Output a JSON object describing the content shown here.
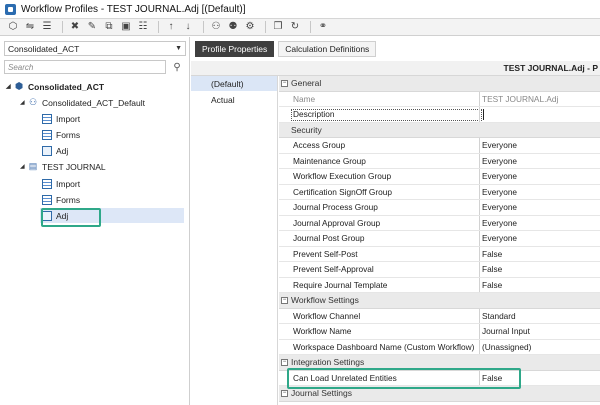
{
  "window": {
    "title": "Workflow Profiles - TEST JOURNAL.Adj [(Default)]"
  },
  "toolbar": {
    "buttons": [
      "cube-icon",
      "filter-icon",
      "list-icon",
      "delete-icon",
      "edit-icon",
      "copy-icon",
      "save-icon",
      "list-edit-icon",
      "up-arrow-icon",
      "down-arrow-icon",
      "add-user-icon",
      "add-user-alt-icon",
      "user-settings-icon",
      "copy-profile-icon",
      "refresh-icon",
      "group-users-icon"
    ]
  },
  "left": {
    "scenario_value": "Consolidated_ACT",
    "search_placeholder": "Search",
    "tree": [
      {
        "label": "Consolidated_ACT",
        "level": 0,
        "icon": "cube-icon",
        "bold": true
      },
      {
        "label": "Consolidated_ACT_Default",
        "level": 1,
        "icon": "people-icon"
      },
      {
        "label": "Import",
        "level": 2,
        "icon": "grid-icon"
      },
      {
        "label": "Forms",
        "level": 2,
        "icon": "grid-icon"
      },
      {
        "label": "Adj",
        "level": 2,
        "icon": "doc-icon"
      },
      {
        "label": "TEST JOURNAL",
        "level": 1,
        "icon": "folder-icon"
      },
      {
        "label": "Import",
        "level": 2,
        "icon": "grid-icon"
      },
      {
        "label": "Forms",
        "level": 2,
        "icon": "grid-icon"
      },
      {
        "label": "Adj",
        "level": 2,
        "icon": "doc-icon",
        "selected": true
      }
    ]
  },
  "right": {
    "tabs": [
      {
        "label": "Profile Properties",
        "active": true
      },
      {
        "label": "Calculation Definitions",
        "active": false
      }
    ],
    "header_title": "TEST JOURNAL.Adj - P",
    "profiles": [
      "(Default)",
      "Actual"
    ],
    "properties": [
      {
        "type": "cat",
        "label": "General"
      },
      {
        "type": "prop",
        "name": "Name",
        "value": "TEST JOURNAL.Adj",
        "readonly": true
      },
      {
        "type": "prop",
        "name": "Description",
        "value": "",
        "editing": true
      },
      {
        "type": "cat",
        "label": "Security"
      },
      {
        "type": "prop",
        "name": "Access Group",
        "value": "Everyone"
      },
      {
        "type": "prop",
        "name": "Maintenance Group",
        "value": "Everyone"
      },
      {
        "type": "prop",
        "name": "Workflow Execution Group",
        "value": "Everyone"
      },
      {
        "type": "prop",
        "name": "Certification SignOff Group",
        "value": "Everyone"
      },
      {
        "type": "prop",
        "name": "Journal Process Group",
        "value": "Everyone"
      },
      {
        "type": "prop",
        "name": "Journal Approval Group",
        "value": "Everyone"
      },
      {
        "type": "prop",
        "name": "Journal Post Group",
        "value": "Everyone"
      },
      {
        "type": "prop",
        "name": "Prevent Self-Post",
        "value": "False"
      },
      {
        "type": "prop",
        "name": "Prevent Self-Approval",
        "value": "False"
      },
      {
        "type": "prop",
        "name": "Require Journal Template",
        "value": "False"
      },
      {
        "type": "cat",
        "label": "Workflow Settings"
      },
      {
        "type": "prop",
        "name": "Workflow Channel",
        "value": "Standard"
      },
      {
        "type": "prop",
        "name": "Workflow Name",
        "value": "Journal Input"
      },
      {
        "type": "prop",
        "name": "Workspace Dashboard Name (Custom Workflow)",
        "value": "(Unassigned)"
      },
      {
        "type": "cat",
        "label": "Integration Settings"
      },
      {
        "type": "prop",
        "name": "Can Load Unrelated Entities",
        "value": "False"
      },
      {
        "type": "cat",
        "label": "Journal Settings"
      }
    ]
  }
}
